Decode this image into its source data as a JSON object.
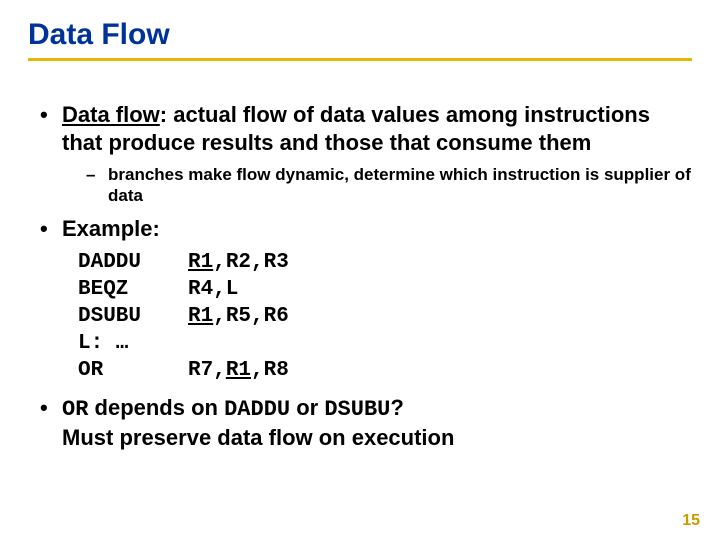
{
  "title": "Data Flow",
  "bullets": {
    "b1_term": "Data flow",
    "b1_rest": ": actual flow of data values among instructions that produce results and those that consume them",
    "b1_sub": "branches make flow dynamic, determine which instruction is supplier of data",
    "b2": "Example:",
    "b3_pre": " depends on ",
    "b3_or": "OR",
    "b3_daddu": "DADDU",
    "b3_mid": " or ",
    "b3_dsubu": "DSUBU",
    "b3_q": "?",
    "b3_line2": "Must preserve data flow on execution"
  },
  "code": {
    "r1_op": "DADDU",
    "r1_a_ul": "R1",
    "r1_rest": ",R2,R3",
    "r2_op": "BEQZ",
    "r2_args": "R4,L",
    "r3_op": "DSUBU",
    "r3_a_ul": "R1",
    "r3_rest": ",R5,R6",
    "r4": "L: …",
    "r5_op": "OR",
    "r5_a": "R7,",
    "r5_b_ul": "R1",
    "r5_c": ",R8"
  },
  "pagenum": "15"
}
